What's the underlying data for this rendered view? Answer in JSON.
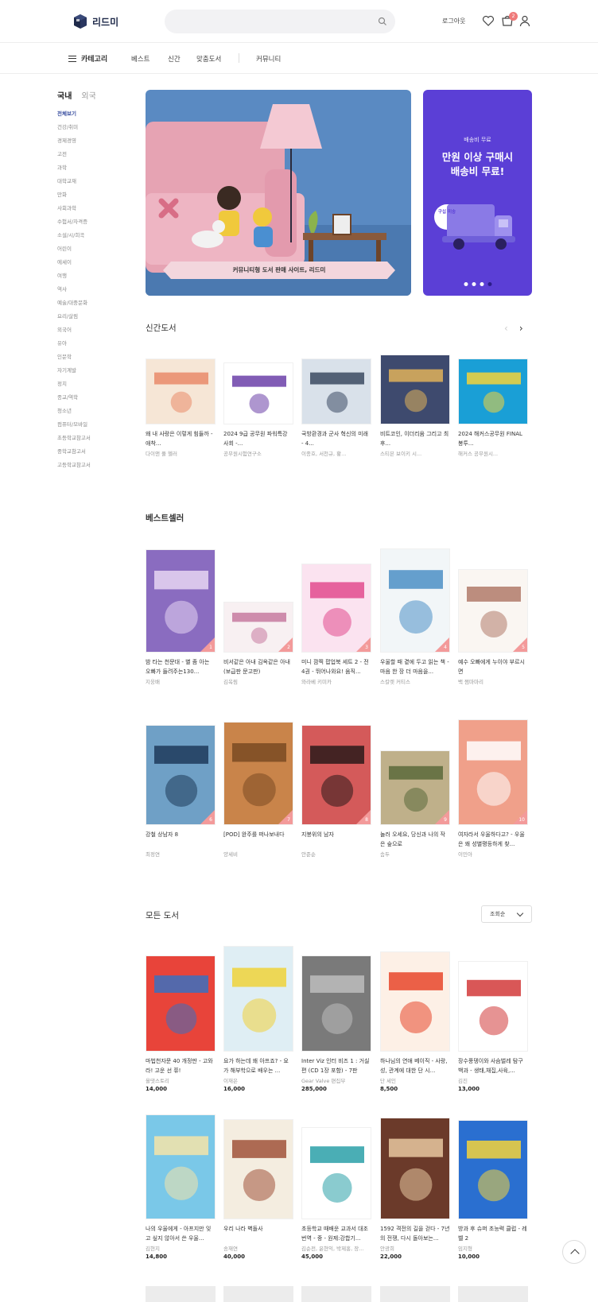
{
  "header": {
    "logo_text": "리드미",
    "search_placeholder": "",
    "login_label": "로그아웃",
    "cart_count": "2"
  },
  "nav": {
    "category_label": "카테고리",
    "links": [
      "베스트",
      "신간",
      "맞춤도서",
      "커뮤니티"
    ]
  },
  "sidebar": {
    "tab_domestic": "국내",
    "tab_foreign": "외국",
    "items": [
      "전체보기",
      "건강/취미",
      "경제경영",
      "고전",
      "과학",
      "대학교재",
      "만화",
      "사회과학",
      "수험서/자격증",
      "소설/시/희곡",
      "어린이",
      "에세이",
      "여행",
      "역사",
      "예술/대중문화",
      "요리/살림",
      "외국어",
      "유아",
      "인문학",
      "자기계발",
      "정치",
      "종교/역학",
      "청소년",
      "컴퓨터/모바일",
      "초등학교참고서",
      "중학교참고서",
      "고등학교참고서"
    ]
  },
  "hero": {
    "caption": "커뮤니티형 도서 판매 사이트, 리드미"
  },
  "promo": {
    "subtitle": "배송비 무료",
    "title_line1": "만원 이상 구매시",
    "title_line2": "배송비 무료!",
    "truck_label": "구십 미송"
  },
  "new_books": {
    "title": "신간도서",
    "items": [
      {
        "title": "왜 내 사랑은 이렇게 힘들까 - 애착...",
        "author": "다이앤 풀 헬러"
      },
      {
        "title": "2024 9급 공무원 파워특강 사회 -...",
        "author": "공무원시험연구소"
      },
      {
        "title": "국방환경과 군사 혁신의 미래 - 4...",
        "author": "이종호, 서천규, 황..."
      },
      {
        "title": "비트코인, 이더리움 그리고 최후...",
        "author": "스티븐 보이키 시..."
      },
      {
        "title": "2024 해커스공무원 FINAL 봉투...",
        "author": "해커스 공무원시..."
      }
    ]
  },
  "bestseller": {
    "title": "베스트셀러",
    "items": [
      {
        "rank": "1",
        "title": "밤 타는 천문대 - 별 좀 아는 오빠가 들려주는130...",
        "author": "지웅배"
      },
      {
        "rank": "2",
        "title": "비서같은 아내 김옥같은 아내 (보급판 문고판)",
        "author": "김옥림"
      },
      {
        "rank": "3",
        "title": "미니 깜찍 팝업북 세트 2 - 전4권 - 뛰어나와요! 움직...",
        "author": "와라베 키미카"
      },
      {
        "rank": "4",
        "title": "우울할 때 곁에 두고 읽는 책 - 마음 한 장 더 마음을...",
        "author": "스칼렛 커티스"
      },
      {
        "rank": "5",
        "title": "예수 오빠에게 누이야 부르시면",
        "author": "백 쩜마마리"
      },
      {
        "rank": "6",
        "title": "강철 상남자 8",
        "author": "최정연"
      },
      {
        "rank": "7",
        "title": "[POD] 완주를 떠나보내다",
        "author": "양세비"
      },
      {
        "rank": "8",
        "title": "지붕위의 남자",
        "author": "안준순"
      },
      {
        "rank": "9",
        "title": "놀러 오세요, 당신과 나의 작은 숲으로",
        "author": "솜두"
      },
      {
        "rank": "10",
        "title": "여자라서 우울하다고? - 우울은 왜 성별평등하게 찾...",
        "author": "이민아"
      }
    ]
  },
  "all_books": {
    "title": "모든 도서",
    "sort_label": "조회순",
    "items": [
      {
        "title": "마법천자문 40 개정판 - 고와라! 고운 선 쮸!",
        "author": "올댓스토리",
        "price": "14,000"
      },
      {
        "title": "요가 하는데 왜 아프죠? - 요가 해부학으로 배우는 ...",
        "author": "이재은",
        "price": "16,000"
      },
      {
        "title": "Inter Viz 인터 비즈 1 : 거실편 (CD 1장 포함) - 7판",
        "author": "Gear Valve 편집부",
        "price": "285,000"
      },
      {
        "title": "하나님의 연애 베이직 - 사랑, 성, 관계에 대한 단 시...",
        "author": "단 세인",
        "price": "8,500"
      },
      {
        "title": "장수풍뎅이와 사슴벌레 탐구백과 - 생태,채집,사육,...",
        "author": "김진",
        "price": "13,000"
      },
      {
        "title": "나의 우울에게 - 아프지만 잊고 싶지 않아서 쓴 우울...",
        "author": "김현지",
        "price": "14,800"
      },
      {
        "title": "우리 나라 벽돌사",
        "author": "송재연",
        "price": "40,000"
      },
      {
        "title": "초등학교 때배운 교과서 대조번역 - 중 - 원제:강합기...",
        "author": "김순전, 윤현익, 박제홍, 장...",
        "price": "45,000"
      },
      {
        "title": "1592 격전의 길을 걷다 - 7년의 전쟁, 다시 돌아보는...",
        "author": "안광희",
        "price": "22,000"
      },
      {
        "title": "방과 후 슈퍼 초능력 클럽 - 레벨 2",
        "author": "임지형",
        "price": "10,000"
      }
    ]
  }
}
